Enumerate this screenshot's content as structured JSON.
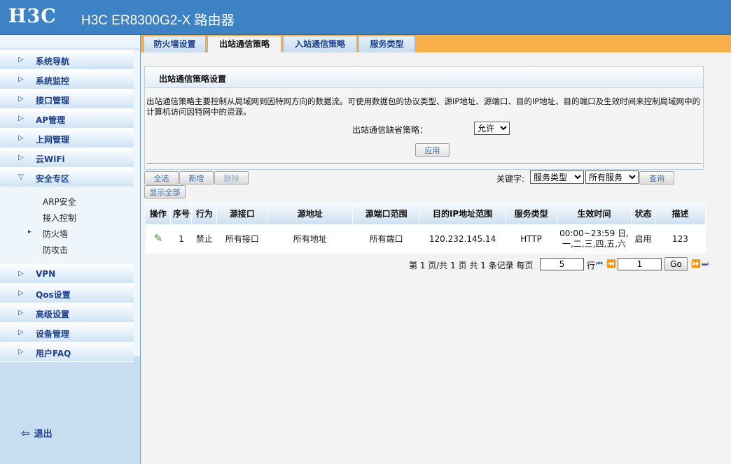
{
  "header": {
    "logo": "H3C",
    "title": "H3C ER8300G2-X 路由器"
  },
  "sidebar": {
    "items": [
      {
        "label": "系统导航"
      },
      {
        "label": "系统监控"
      },
      {
        "label": "接口管理"
      },
      {
        "label": "AP管理"
      },
      {
        "label": "上网管理"
      },
      {
        "label": "云WiFi"
      },
      {
        "label": "安全专区"
      }
    ],
    "sub_items": [
      {
        "label": "ARP安全"
      },
      {
        "label": "接入控制"
      },
      {
        "label": "防火墙"
      },
      {
        "label": "防攻击"
      }
    ],
    "items_after": [
      {
        "label": "VPN"
      },
      {
        "label": "Qos设置"
      },
      {
        "label": "高级设置"
      },
      {
        "label": "设备管理"
      },
      {
        "label": "用户FAQ"
      }
    ],
    "logout": "退出"
  },
  "tabs": [
    {
      "label": "防火墙设置"
    },
    {
      "label": "出站通信策略"
    },
    {
      "label": "入站通信策略"
    },
    {
      "label": "服务类型"
    }
  ],
  "panel": {
    "title": "出站通信策略设置",
    "description": "出站通信策略主要控制从局域网到因特网方向的数据流。可使用数据包的协议类型、源IP地址、源端口、目的IP地址、目的端口及生效时间来控制局域网中的计算机访问因特网中的资源。",
    "default_policy_label": "出站通信缺省策略：",
    "default_policy_value": "允许",
    "apply_label": "应用"
  },
  "toolbar": {
    "select_all": "全选",
    "add": "新增",
    "delete": "删除",
    "show_all": "显示全部",
    "keyword_label": "关键字:",
    "keyword_field": "服务类型",
    "keyword_value": "所有服务",
    "search": "查询"
  },
  "table": {
    "headers": [
      "操作",
      "序号",
      "行为",
      "源接口",
      "源地址",
      "源端口范围",
      "目的IP地址范围",
      "服务类型",
      "生效时间",
      "状态",
      "描述"
    ],
    "rows": [
      {
        "index": "1",
        "action": "禁止",
        "src_if": "所有接口",
        "src_addr": "所有地址",
        "src_port": "所有端口",
        "dst_ip": "120.232.145.14",
        "service": "HTTP",
        "time_line1": "00:00~23:59 日,",
        "time_line2": "一,二,三,四,五,六",
        "status": "启用",
        "desc": "123"
      }
    ]
  },
  "pager": {
    "summary": "第 1 页/共 1 页 共 1 条记录 每页",
    "per_page": "5",
    "row_unit": "行",
    "page_input": "1",
    "go": "Go"
  }
}
